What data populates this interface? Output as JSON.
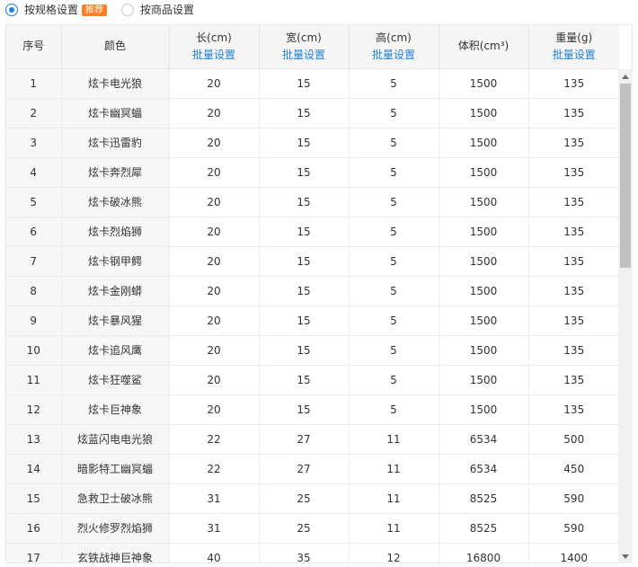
{
  "mode": {
    "by_spec_label": "按规格设置",
    "recommended_badge": "推荐",
    "by_product_label": "按商品设置",
    "selected": "by_spec"
  },
  "table": {
    "headers": {
      "index": "序号",
      "color": "颜色",
      "length": "长(cm)",
      "width": "宽(cm)",
      "height": "高(cm)",
      "volume": "体积(cm³)",
      "weight": "重量(g)"
    },
    "batch_label": "批量设置",
    "rows": [
      {
        "index": "1",
        "color": "炫卡电光狼",
        "length": "20",
        "width": "15",
        "height": "5",
        "volume": "1500",
        "weight": "135"
      },
      {
        "index": "2",
        "color": "炫卡幽冥蝠",
        "length": "20",
        "width": "15",
        "height": "5",
        "volume": "1500",
        "weight": "135"
      },
      {
        "index": "3",
        "color": "炫卡迅雷豹",
        "length": "20",
        "width": "15",
        "height": "5",
        "volume": "1500",
        "weight": "135"
      },
      {
        "index": "4",
        "color": "炫卡奔烈犀",
        "length": "20",
        "width": "15",
        "height": "5",
        "volume": "1500",
        "weight": "135"
      },
      {
        "index": "5",
        "color": "炫卡破冰熊",
        "length": "20",
        "width": "15",
        "height": "5",
        "volume": "1500",
        "weight": "135"
      },
      {
        "index": "6",
        "color": "炫卡烈焰狮",
        "length": "20",
        "width": "15",
        "height": "5",
        "volume": "1500",
        "weight": "135"
      },
      {
        "index": "7",
        "color": "炫卡钢甲鳄",
        "length": "20",
        "width": "15",
        "height": "5",
        "volume": "1500",
        "weight": "135"
      },
      {
        "index": "8",
        "color": "炫卡金刚蟒",
        "length": "20",
        "width": "15",
        "height": "5",
        "volume": "1500",
        "weight": "135"
      },
      {
        "index": "9",
        "color": "炫卡暴风猩",
        "length": "20",
        "width": "15",
        "height": "5",
        "volume": "1500",
        "weight": "135"
      },
      {
        "index": "10",
        "color": "炫卡追风鹰",
        "length": "20",
        "width": "15",
        "height": "5",
        "volume": "1500",
        "weight": "135"
      },
      {
        "index": "11",
        "color": "炫卡狂噬鲨",
        "length": "20",
        "width": "15",
        "height": "5",
        "volume": "1500",
        "weight": "135"
      },
      {
        "index": "12",
        "color": "炫卡巨神象",
        "length": "20",
        "width": "15",
        "height": "5",
        "volume": "1500",
        "weight": "135"
      },
      {
        "index": "13",
        "color": "炫蓝闪电电光狼",
        "length": "22",
        "width": "27",
        "height": "11",
        "volume": "6534",
        "weight": "500"
      },
      {
        "index": "14",
        "color": "暗影特工幽冥蝠",
        "length": "22",
        "width": "27",
        "height": "11",
        "volume": "6534",
        "weight": "450"
      },
      {
        "index": "15",
        "color": "急救卫士破冰熊",
        "length": "31",
        "width": "25",
        "height": "11",
        "volume": "8525",
        "weight": "590"
      },
      {
        "index": "16",
        "color": "烈火修罗烈焰狮",
        "length": "31",
        "width": "25",
        "height": "11",
        "volume": "8525",
        "weight": "590"
      },
      {
        "index": "17",
        "color": "玄铁战神巨神象",
        "length": "40",
        "width": "35",
        "height": "12",
        "volume": "16800",
        "weight": "1400"
      }
    ]
  },
  "colors": {
    "accent": "#1f7ed6",
    "badge": "#ff7d24",
    "header_bg": "#f5f5f5",
    "border": "#e6e6e6"
  }
}
